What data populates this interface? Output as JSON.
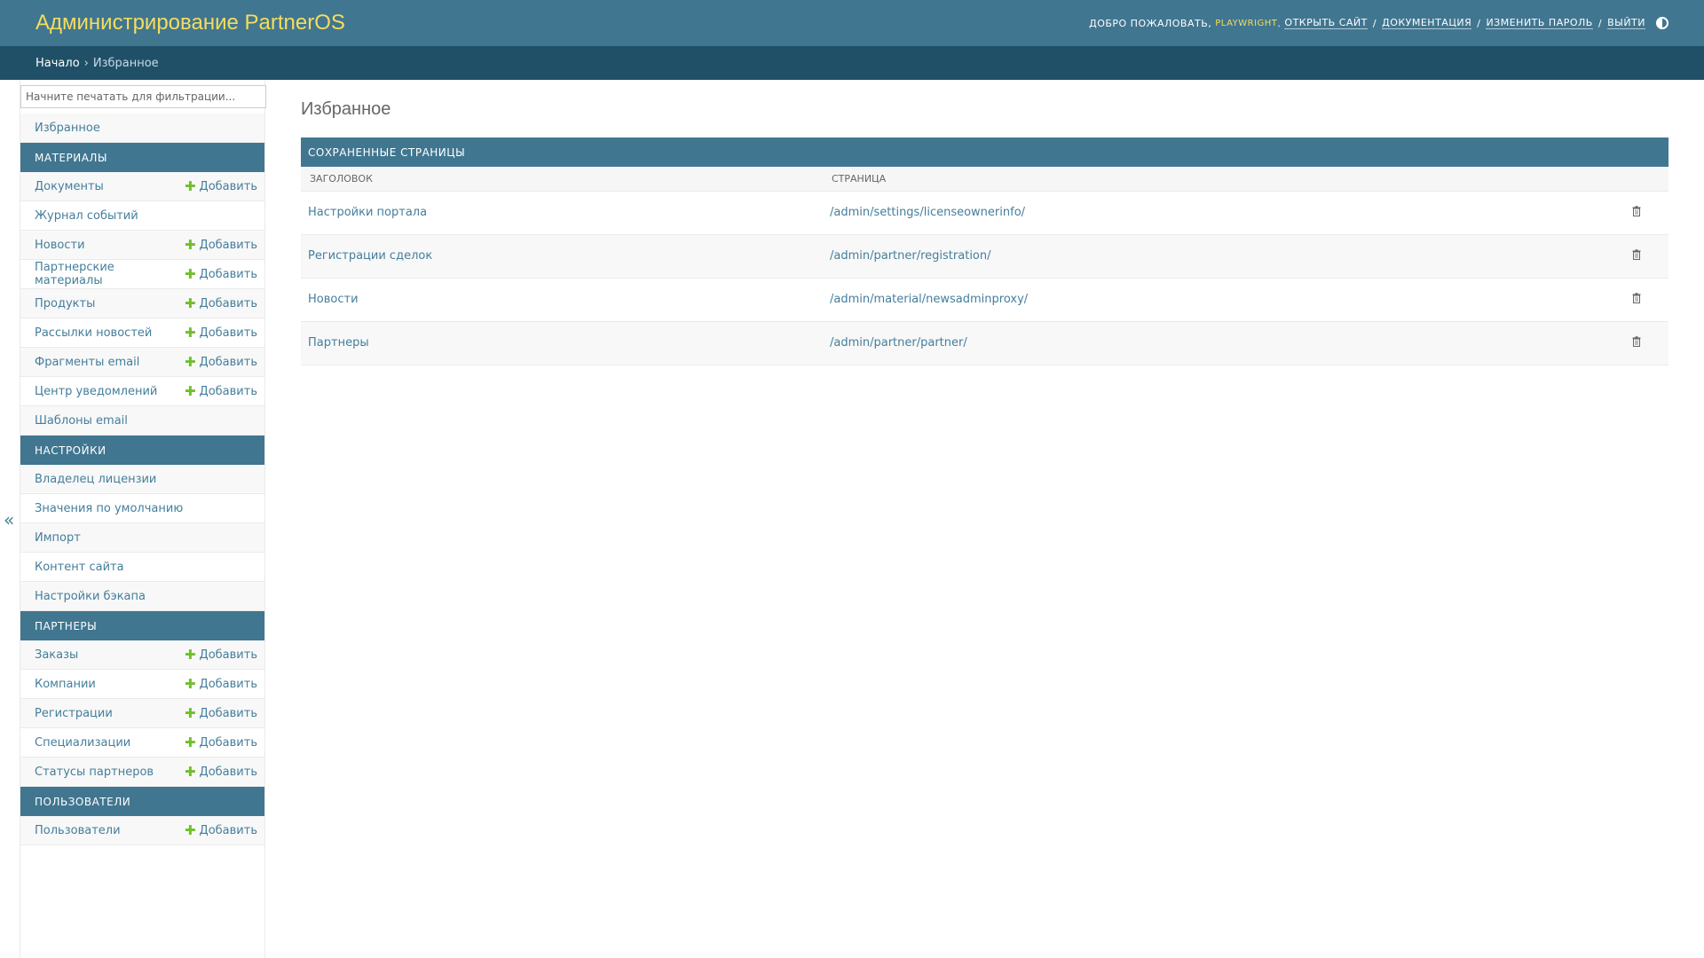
{
  "header": {
    "site_name": "Администрирование PartnerOS",
    "welcome": "Добро пожаловать,",
    "username": "PLAYWRIGHT",
    "view_site": "Открыть сайт",
    "docs": "Документация",
    "change_password": "Изменить пароль",
    "logout": "Выйти",
    "separator": "/",
    "theme_icon": "theme-toggle-icon"
  },
  "breadcrumbs": {
    "home": "Начало",
    "separator": "›",
    "current": "Избранное"
  },
  "sidebar": {
    "filter_placeholder": "Начните печатать для фильтрации...",
    "favorites_label": "Избранное",
    "add_label": "Добавить",
    "add_icon": "plus-icon",
    "collapse_glyph": "«",
    "sections": [
      {
        "caption": "Материалы",
        "items": [
          {
            "label": "Документы",
            "add": true
          },
          {
            "label": "Журнал событий",
            "add": false
          },
          {
            "label": "Новости",
            "add": true
          },
          {
            "label": "Партнерские материалы",
            "add": true
          },
          {
            "label": "Продукты",
            "add": true
          },
          {
            "label": "Рассылки новостей",
            "add": true
          },
          {
            "label": "Фрагменты email",
            "add": true
          },
          {
            "label": "Центр уведомлений",
            "add": true
          },
          {
            "label": "Шаблоны email",
            "add": false
          }
        ]
      },
      {
        "caption": "Настройки",
        "items": [
          {
            "label": "Владелец лицензии",
            "add": false
          },
          {
            "label": "Значения по умолчанию",
            "add": false
          },
          {
            "label": "Импорт",
            "add": false
          },
          {
            "label": "Контент сайта",
            "add": false
          },
          {
            "label": "Настройки бэкапа",
            "add": false
          }
        ]
      },
      {
        "caption": "Партнеры",
        "items": [
          {
            "label": "Заказы",
            "add": true
          },
          {
            "label": "Компании",
            "add": true
          },
          {
            "label": "Регистрации",
            "add": true
          },
          {
            "label": "Специализации",
            "add": true
          },
          {
            "label": "Статусы партнеров",
            "add": true
          }
        ]
      },
      {
        "caption": "Пользователи",
        "items": [
          {
            "label": "Пользователи",
            "add": true
          }
        ]
      }
    ]
  },
  "main": {
    "title": "Избранное",
    "module_caption": "Сохраненные страницы",
    "columns": [
      "Заголовок",
      "Страница"
    ],
    "delete_icon": "trash-icon",
    "rows": [
      {
        "title": "Настройки портала",
        "page": "/admin/settings/licenseownerinfo/"
      },
      {
        "title": "Регистрации сделок",
        "page": "/admin/partner/registration/"
      },
      {
        "title": "Новости",
        "page": "/admin/material/newsadminproxy/"
      },
      {
        "title": "Партнеры",
        "page": "/admin/partner/partner/"
      }
    ]
  },
  "colors": {
    "header_bg": "#417690",
    "breadcrumbs_bg": "#205067",
    "site_name": "#f5dd5d",
    "link": "#447e9b",
    "add_plus": "#70bf2b"
  }
}
